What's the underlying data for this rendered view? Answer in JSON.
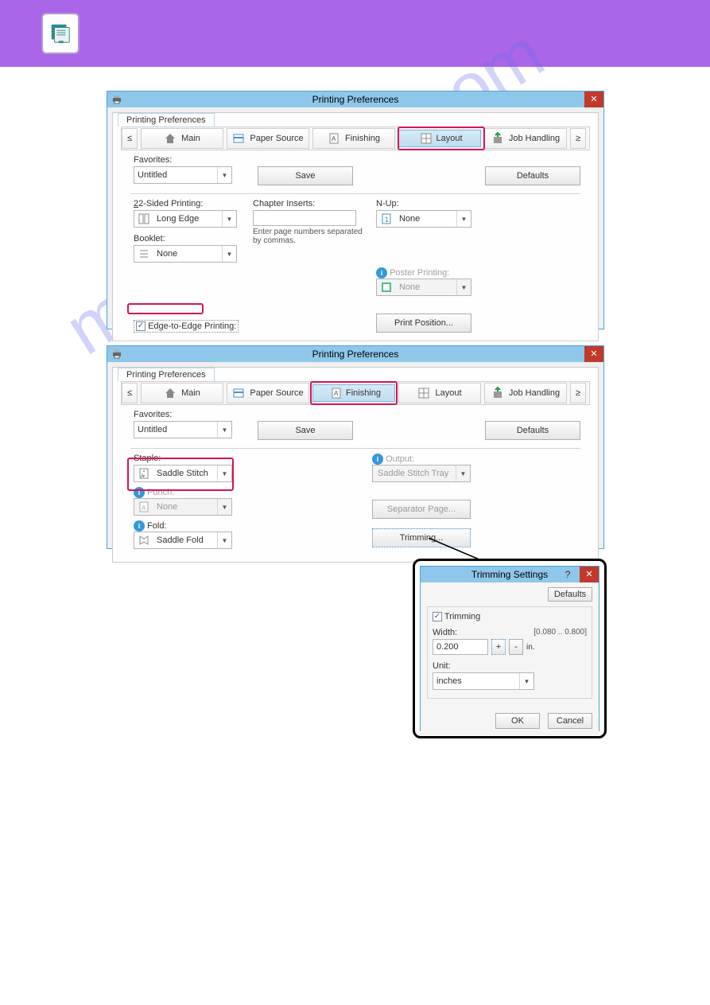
{
  "watermark": "manualshive.com",
  "win1": {
    "title": "Printing Preferences",
    "tab_label": "Printing Preferences",
    "nav_prev": "≤",
    "nav_next": "≥",
    "tabs": {
      "main": "Main",
      "paper": "Paper Source",
      "finishing": "Finishing",
      "layout": "Layout",
      "job": "Job Handling"
    },
    "fav_label": "Favorites:",
    "fav_value": "Untitled",
    "save": "Save",
    "defaults": "Defaults",
    "twosided_label": "2-Sided Printing:",
    "twosided_value": "Long Edge",
    "booklet_label": "Booklet:",
    "booklet_value": "None",
    "chapter_label": "Chapter Inserts:",
    "chapter_hint": "Enter page numbers separated by commas.",
    "nup_label": "N-Up:",
    "nup_value": "None",
    "poster_label": "Poster Printing:",
    "poster_value": "None",
    "printpos": "Print Position...",
    "edge_cb": "Edge-to-Edge Printing:"
  },
  "win2": {
    "title": "Printing Preferences",
    "tab_label": "Printing Preferences",
    "tabs": {
      "main": "Main",
      "paper": "Paper Source",
      "finishing": "Finishing",
      "layout": "Layout",
      "job": "Job Handling"
    },
    "fav_label": "Favorites:",
    "fav_value": "Untitled",
    "save": "Save",
    "defaults": "Defaults",
    "staple_label": "Staple:",
    "staple_value": "Saddle Stitch",
    "punch_label": "Punch:",
    "punch_value": "None",
    "fold_label": "Fold:",
    "fold_value": "Saddle Fold",
    "output_label": "Output:",
    "output_value": "Saddle Stitch Tray",
    "separator": "Separator Page...",
    "trimming": "Trimming..."
  },
  "win3": {
    "title": "Trimming Settings",
    "help": "?",
    "defaults": "Defaults",
    "trim_cb": "Trimming",
    "width_label": "Width:",
    "width_range": "[0.080 .. 0.800]",
    "width_value": "0.200",
    "plus": "+",
    "minus": "-",
    "width_unit_suffix": "in.",
    "unit_label": "Unit:",
    "unit_value": "inches",
    "ok": "OK",
    "cancel": "Cancel"
  }
}
